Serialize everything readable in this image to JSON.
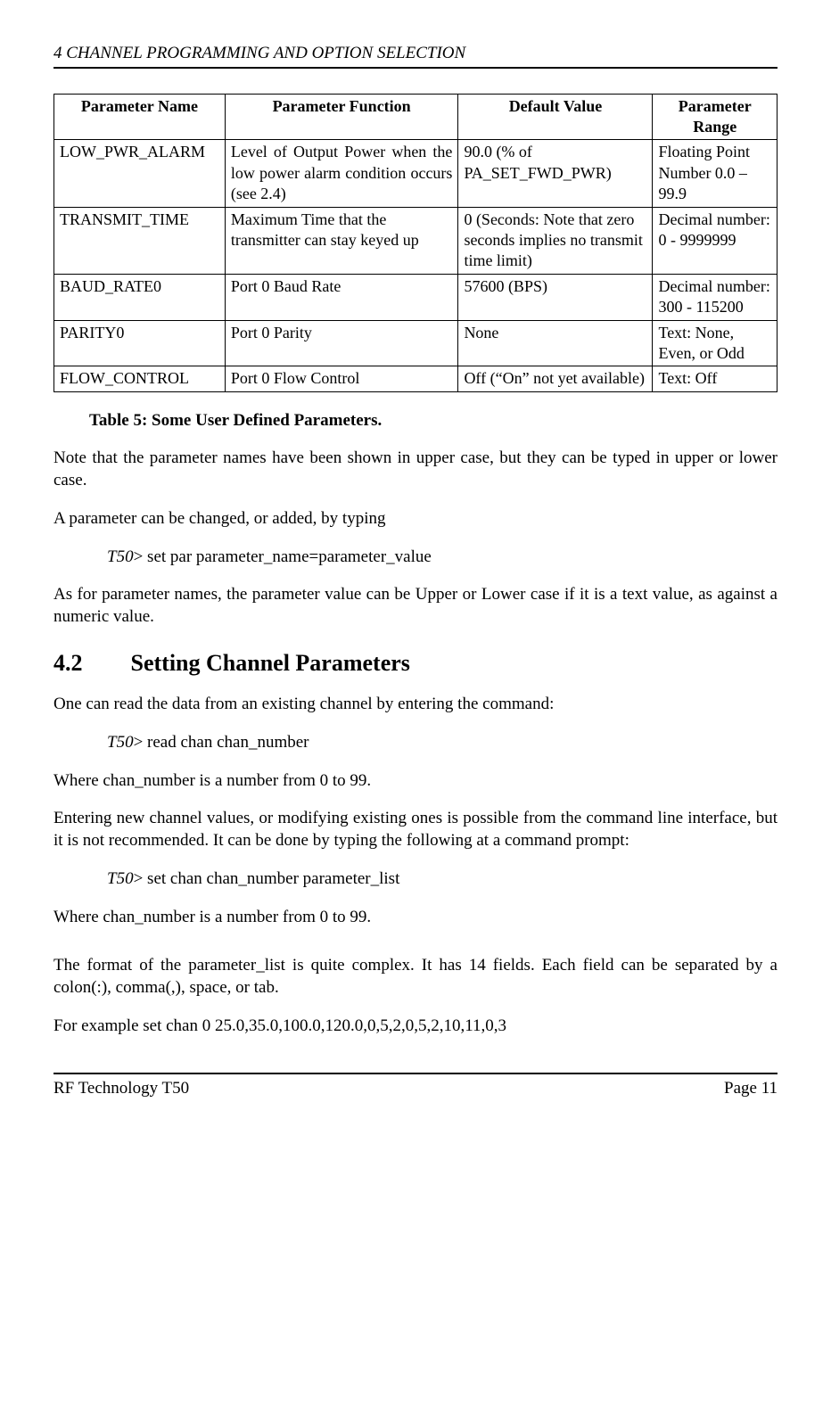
{
  "header": "4  CHANNEL PROGRAMMING AND OPTION SELECTION",
  "table": {
    "headers": [
      "Parameter Name",
      "Parameter Function",
      "Default Value",
      "Parameter Range"
    ],
    "rows": [
      {
        "name": "LOW_PWR_ALARM",
        "func": "Level of Output Power when the low power alarm condition occurs (see 2.4)",
        "def": "90.0 (% of PA_SET_FWD_PWR)",
        "range": "Floating Point Number 0.0 – 99.9"
      },
      {
        "name": "TRANSMIT_TIME",
        "func": "Maximum Time that the transmitter can stay keyed up",
        "def": "0 (Seconds: Note that zero seconds implies no transmit time limit)",
        "range": "Decimal number: 0 - 9999999"
      },
      {
        "name": "BAUD_RATE0",
        "func": "Port 0 Baud Rate",
        "def": "57600 (BPS)",
        "range": "Decimal number: 300 - 115200"
      },
      {
        "name": "PARITY0",
        "func": "Port 0 Parity",
        "def": "None",
        "range": "Text: None, Even, or Odd"
      },
      {
        "name": "FLOW_CONTROL",
        "func": "Port 0 Flow Control",
        "def": "Off (“On” not yet available)",
        "range": "Text: Off"
      }
    ]
  },
  "caption": "Table 5:  Some User Defined Parameters.",
  "body": {
    "p1": "Note that the parameter names have been shown in upper case, but they can be typed in upper or lower case.",
    "p2": "A parameter can be changed, or added, by typing",
    "cmd1_prefix": "T50",
    "cmd1_rest": "> set par parameter_name=parameter_value",
    "p3": "As for parameter names, the parameter value can be Upper or Lower case if it is a text value, as against a numeric value.",
    "sec_num": "4.2",
    "sec_title": "Setting Channel Parameters",
    "p4": "One can read the data from an existing channel by entering the command:",
    "cmd2_prefix": "T50",
    "cmd2_rest": "> read chan chan_number",
    "p5": "Where chan_number is a number from 0 to 99.",
    "p6": "Entering new channel values, or modifying existing ones is possible from the command line interface, but it is not recommended.   It can be done by typing the following at a command prompt:",
    "cmd3_prefix": "T50",
    "cmd3_rest": "> set chan chan_number parameter_list",
    "p7": "Where chan_number is a number from 0 to 99.",
    "p8": "The format of the parameter_list is quite complex.  It has 14 fields.  Each field can be separated by a colon(:), comma(,), space, or tab.",
    "p9": "For example set chan 0 25.0,35.0,100.0,120.0,0,5,2,0,5,2,10,11,0,3"
  },
  "footer": {
    "left": "RF Technology   T50",
    "right": "Page 11"
  }
}
